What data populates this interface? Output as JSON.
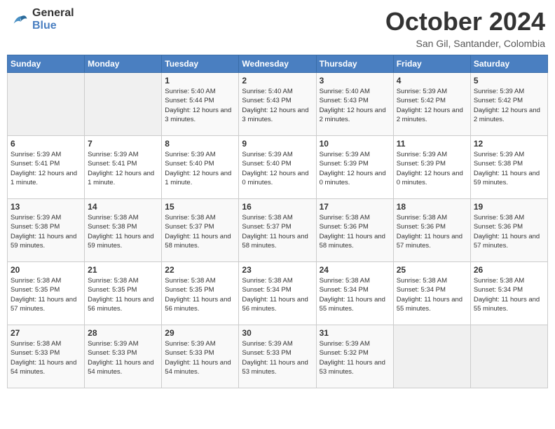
{
  "logo": {
    "text_general": "General",
    "text_blue": "Blue"
  },
  "header": {
    "month": "October 2024",
    "location": "San Gil, Santander, Colombia"
  },
  "weekdays": [
    "Sunday",
    "Monday",
    "Tuesday",
    "Wednesday",
    "Thursday",
    "Friday",
    "Saturday"
  ],
  "weeks": [
    [
      {
        "day": "",
        "info": ""
      },
      {
        "day": "",
        "info": ""
      },
      {
        "day": "1",
        "info": "Sunrise: 5:40 AM\nSunset: 5:44 PM\nDaylight: 12 hours\nand 3 minutes."
      },
      {
        "day": "2",
        "info": "Sunrise: 5:40 AM\nSunset: 5:43 PM\nDaylight: 12 hours\nand 3 minutes."
      },
      {
        "day": "3",
        "info": "Sunrise: 5:40 AM\nSunset: 5:43 PM\nDaylight: 12 hours\nand 2 minutes."
      },
      {
        "day": "4",
        "info": "Sunrise: 5:39 AM\nSunset: 5:42 PM\nDaylight: 12 hours\nand 2 minutes."
      },
      {
        "day": "5",
        "info": "Sunrise: 5:39 AM\nSunset: 5:42 PM\nDaylight: 12 hours\nand 2 minutes."
      }
    ],
    [
      {
        "day": "6",
        "info": "Sunrise: 5:39 AM\nSunset: 5:41 PM\nDaylight: 12 hours\nand 1 minute."
      },
      {
        "day": "7",
        "info": "Sunrise: 5:39 AM\nSunset: 5:41 PM\nDaylight: 12 hours\nand 1 minute."
      },
      {
        "day": "8",
        "info": "Sunrise: 5:39 AM\nSunset: 5:40 PM\nDaylight: 12 hours\nand 1 minute."
      },
      {
        "day": "9",
        "info": "Sunrise: 5:39 AM\nSunset: 5:40 PM\nDaylight: 12 hours\nand 0 minutes."
      },
      {
        "day": "10",
        "info": "Sunrise: 5:39 AM\nSunset: 5:39 PM\nDaylight: 12 hours\nand 0 minutes."
      },
      {
        "day": "11",
        "info": "Sunrise: 5:39 AM\nSunset: 5:39 PM\nDaylight: 12 hours\nand 0 minutes."
      },
      {
        "day": "12",
        "info": "Sunrise: 5:39 AM\nSunset: 5:38 PM\nDaylight: 11 hours\nand 59 minutes."
      }
    ],
    [
      {
        "day": "13",
        "info": "Sunrise: 5:39 AM\nSunset: 5:38 PM\nDaylight: 11 hours\nand 59 minutes."
      },
      {
        "day": "14",
        "info": "Sunrise: 5:38 AM\nSunset: 5:38 PM\nDaylight: 11 hours\nand 59 minutes."
      },
      {
        "day": "15",
        "info": "Sunrise: 5:38 AM\nSunset: 5:37 PM\nDaylight: 11 hours\nand 58 minutes."
      },
      {
        "day": "16",
        "info": "Sunrise: 5:38 AM\nSunset: 5:37 PM\nDaylight: 11 hours\nand 58 minutes."
      },
      {
        "day": "17",
        "info": "Sunrise: 5:38 AM\nSunset: 5:36 PM\nDaylight: 11 hours\nand 58 minutes."
      },
      {
        "day": "18",
        "info": "Sunrise: 5:38 AM\nSunset: 5:36 PM\nDaylight: 11 hours\nand 57 minutes."
      },
      {
        "day": "19",
        "info": "Sunrise: 5:38 AM\nSunset: 5:36 PM\nDaylight: 11 hours\nand 57 minutes."
      }
    ],
    [
      {
        "day": "20",
        "info": "Sunrise: 5:38 AM\nSunset: 5:35 PM\nDaylight: 11 hours\nand 57 minutes."
      },
      {
        "day": "21",
        "info": "Sunrise: 5:38 AM\nSunset: 5:35 PM\nDaylight: 11 hours\nand 56 minutes."
      },
      {
        "day": "22",
        "info": "Sunrise: 5:38 AM\nSunset: 5:35 PM\nDaylight: 11 hours\nand 56 minutes."
      },
      {
        "day": "23",
        "info": "Sunrise: 5:38 AM\nSunset: 5:34 PM\nDaylight: 11 hours\nand 56 minutes."
      },
      {
        "day": "24",
        "info": "Sunrise: 5:38 AM\nSunset: 5:34 PM\nDaylight: 11 hours\nand 55 minutes."
      },
      {
        "day": "25",
        "info": "Sunrise: 5:38 AM\nSunset: 5:34 PM\nDaylight: 11 hours\nand 55 minutes."
      },
      {
        "day": "26",
        "info": "Sunrise: 5:38 AM\nSunset: 5:34 PM\nDaylight: 11 hours\nand 55 minutes."
      }
    ],
    [
      {
        "day": "27",
        "info": "Sunrise: 5:38 AM\nSunset: 5:33 PM\nDaylight: 11 hours\nand 54 minutes."
      },
      {
        "day": "28",
        "info": "Sunrise: 5:39 AM\nSunset: 5:33 PM\nDaylight: 11 hours\nand 54 minutes."
      },
      {
        "day": "29",
        "info": "Sunrise: 5:39 AM\nSunset: 5:33 PM\nDaylight: 11 hours\nand 54 minutes."
      },
      {
        "day": "30",
        "info": "Sunrise: 5:39 AM\nSunset: 5:33 PM\nDaylight: 11 hours\nand 53 minutes."
      },
      {
        "day": "31",
        "info": "Sunrise: 5:39 AM\nSunset: 5:32 PM\nDaylight: 11 hours\nand 53 minutes."
      },
      {
        "day": "",
        "info": ""
      },
      {
        "day": "",
        "info": ""
      }
    ]
  ]
}
